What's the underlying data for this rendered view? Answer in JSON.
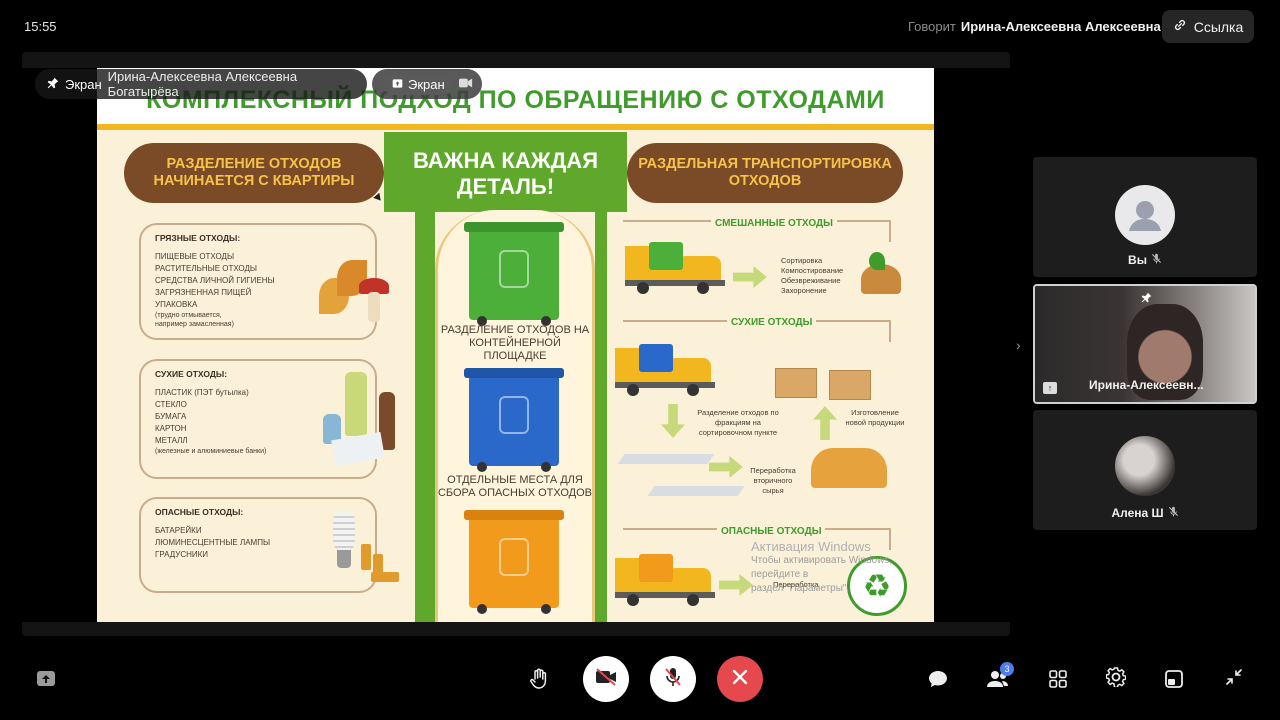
{
  "header": {
    "time": "15:55",
    "speaking_label": "Говорит",
    "speaking_name": "Ирина-Алексеевна Алексеевна Б.",
    "link_label": "Ссылка"
  },
  "presenter_bar": {
    "mode_label": "Экран",
    "presenter_name": "Ирина-Алексеевна Алексеевна Богатырёва",
    "screen_tag": "Экран"
  },
  "slide": {
    "title": "КОМПЛЕКСНЫЙ ПОДХОД ПО ОБРАЩЕНИЮ С ОТХОДАМИ",
    "left_ribbon": "РАЗДЕЛЕНИЕ ОТХОДОВ НАЧИНАЕТСЯ С КВАРТИРЫ",
    "center_title": "ВАЖНА КАЖДАЯ ДЕТАЛЬ!",
    "right_ribbon": "РАЗДЕЛЬНАЯ ТРАНСПОРТИРОВКА ОТХОДОВ",
    "dirty": {
      "heading": "ГРЯЗНЫЕ ОТХОДЫ:",
      "items": [
        "ПИЩЕВЫЕ ОТХОДЫ",
        "РАСТИТЕЛЬНЫЕ ОТХОДЫ",
        "СРЕДСТВА ЛИЧНОЙ ГИГИЕНЫ",
        "ЗАГРЯЗНЕННАЯ ПИЩЕЙ",
        "УПАКОВКА"
      ],
      "note": "(трудно отмывается, например замасленная)"
    },
    "dry": {
      "heading": "СУХИЕ ОТХОДЫ:",
      "items": [
        "ПЛАСТИК (ПЭТ бутылка)",
        "СТЕКЛО",
        "БУМАГА",
        "КАРТОН",
        "МЕТАЛЛ"
      ],
      "note": "(железные и алюминиевые банки)"
    },
    "hazardous": {
      "heading": "ОПАСНЫЕ ОТХОДЫ:",
      "items": [
        "БАТАРЕЙКИ",
        "ЛЮМИНЕСЦЕНТНЫЕ ЛАМПЫ",
        "ГРАДУСНИКИ"
      ]
    },
    "bin_caption_1": "РАЗДЕЛЕНИЕ ОТХОДОВ НА КОНТЕЙНЕРНОЙ ПЛОЩАДКЕ",
    "bin_caption_2": "ОТДЕЛЬНЫЕ МЕСТА ДЛЯ СБОРА ОПАСНЫХ ОТХОДОВ",
    "mixed_label": "СМЕШАННЫЕ ОТХОДЫ",
    "mixed_steps": [
      "Сортировка",
      "Компостирование",
      "Обезвреживание",
      "Захоронение"
    ],
    "dry_label": "СУХИЕ ОТХОДЫ",
    "dry_text_1": "Разделение отходов по фракциям на сортировочном пункте",
    "dry_text_2": "Изготовление новой продукции",
    "dry_text_3": "Переработка вторичного сырья",
    "haz_label": "ОПАСНЫЕ ОТХОДЫ",
    "haz_step": "Переработка",
    "recycle_symbol": "♻",
    "watermark_title": "Активация Windows",
    "watermark_line1": "Чтобы активировать Windows, перейдите в",
    "watermark_line2": "раздел \"Параметры\"."
  },
  "participants": [
    {
      "name": "Вы",
      "muted": true
    },
    {
      "name": "Ирина-Алексеевн...",
      "muted": false,
      "pinned": true
    },
    {
      "name": "Алена Ш",
      "muted": true
    }
  ],
  "toolbar": {
    "participants_count": "3"
  },
  "colors": {
    "slide_green": "#3f9b2b",
    "ribbon_brown": "#7a4b26",
    "bin_green": "#4caf3a",
    "bin_blue": "#2a68c9",
    "bin_orange": "#f29a1c",
    "end_call_red": "#e5484d"
  }
}
